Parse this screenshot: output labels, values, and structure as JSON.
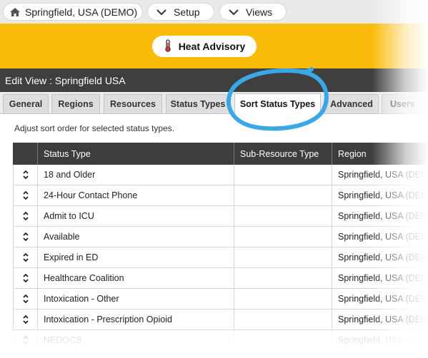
{
  "topbar": {
    "location_label": "Springfield, USA (DEMO)",
    "setup_label": "Setup",
    "views_label": "Views"
  },
  "banner": {
    "advisory_label": "Heat Advisory",
    "color": "#fbbb0a"
  },
  "page": {
    "title": "Edit View : Springfield USA"
  },
  "tabs": [
    {
      "label": "General"
    },
    {
      "label": "Regions"
    },
    {
      "label": "Resources"
    },
    {
      "label": "Status Types"
    },
    {
      "label": "Sort Status Types",
      "active": true
    },
    {
      "label": "Advanced"
    },
    {
      "label": "Users"
    }
  ],
  "instructions": "Adjust sort order for selected status types.",
  "table": {
    "columns": [
      "",
      "Status Type",
      "Sub-Resource Type",
      "Region"
    ],
    "rows": [
      {
        "status_type": "18 and Older",
        "sub_resource_type": "",
        "region": "Springfield, USA (DEMO)"
      },
      {
        "status_type": "24-Hour Contact Phone",
        "sub_resource_type": "",
        "region": "Springfield, USA (DEMO)"
      },
      {
        "status_type": "Admit to ICU",
        "sub_resource_type": "",
        "region": "Springfield, USA (DEMO)"
      },
      {
        "status_type": "Available",
        "sub_resource_type": "",
        "region": "Springfield, USA (DEMO)"
      },
      {
        "status_type": "Expired in ED",
        "sub_resource_type": "",
        "region": "Springfield, USA (DEMO)"
      },
      {
        "status_type": "Healthcare Coalition",
        "sub_resource_type": "",
        "region": "Springfield, USA (DEMO)"
      },
      {
        "status_type": "Intoxication - Other",
        "sub_resource_type": "",
        "region": "Springfield, USA (DEMO)"
      },
      {
        "status_type": "Intoxication - Prescription Opioid",
        "sub_resource_type": "",
        "region": "Springfield, USA (DEMO)"
      },
      {
        "status_type": "NEDOCS",
        "sub_resource_type": "",
        "region": "Springfield, USA (DEMO)"
      }
    ]
  },
  "icons": {
    "home": "home-icon",
    "chevron": "chevron-down-icon",
    "thermometer": "thermometer-icon",
    "sort_handle": "sort-handle-icon"
  },
  "colors": {
    "highlight_circle": "#3aa8e6",
    "header_dark": "#3f3f3f"
  }
}
